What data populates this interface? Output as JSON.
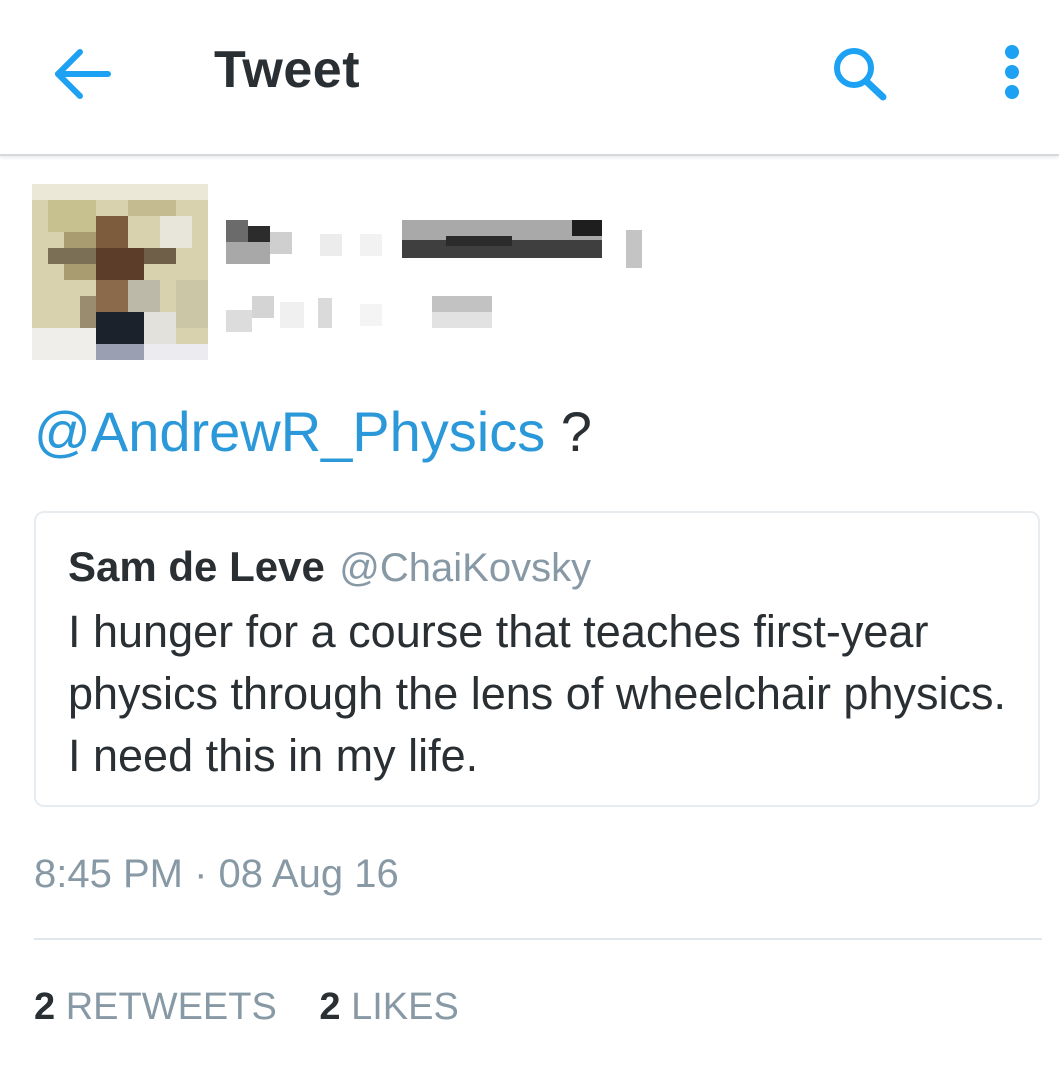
{
  "header": {
    "title": "Tweet",
    "back_icon": "arrow-left-icon",
    "search_icon": "search-icon",
    "more_icon": "more-vertical-icon",
    "accent_color": "#1da1f2"
  },
  "tweet": {
    "avatar": "pixelated-avatar",
    "author_redacted": true,
    "mention": "@AndrewR_Physics",
    "text_rest": " ?",
    "quoted": {
      "name": "Sam de Leve",
      "handle": "@ChaiKovsky",
      "text": "I hunger for a course that teaches first-year physics through the lens of wheelchair physics. I need this in my life."
    },
    "timestamp": "8:45 PM · 08 Aug 16",
    "retweets_count": "2",
    "retweets_label": "RETWEETS",
    "likes_count": "2",
    "likes_label": "LIKES"
  }
}
